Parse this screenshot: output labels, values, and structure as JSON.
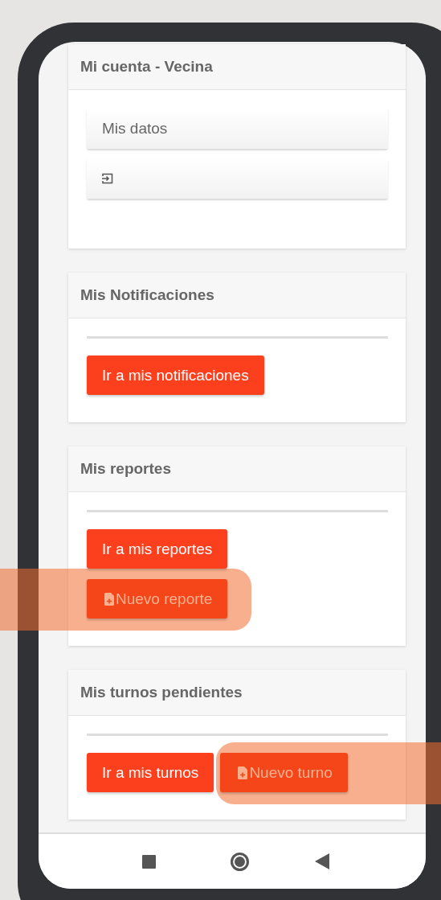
{
  "account": {
    "title": "Mi cuenta - Vecina",
    "items": [
      {
        "kind": "text",
        "label": "Mis datos"
      },
      {
        "kind": "logout"
      }
    ]
  },
  "sections": [
    {
      "title": "Mis Notificaciones",
      "buttons": [
        {
          "label": "Ir a mis notificaciones",
          "icon": false,
          "highlighted": false
        }
      ]
    },
    {
      "title": "Mis reportes",
      "stacked": true,
      "buttons": [
        {
          "label": "Ir a mis reportes",
          "icon": false,
          "highlighted": false
        },
        {
          "label": "Nuevo reporte",
          "icon": true,
          "highlighted": true
        }
      ]
    },
    {
      "title": "Mis turnos pendientes",
      "stacked": false,
      "buttons": [
        {
          "label": "Ir a mis turnos",
          "icon": false,
          "highlighted": false
        },
        {
          "label": "Nuevo turno",
          "icon": true,
          "highlighted": true
        }
      ]
    }
  ]
}
